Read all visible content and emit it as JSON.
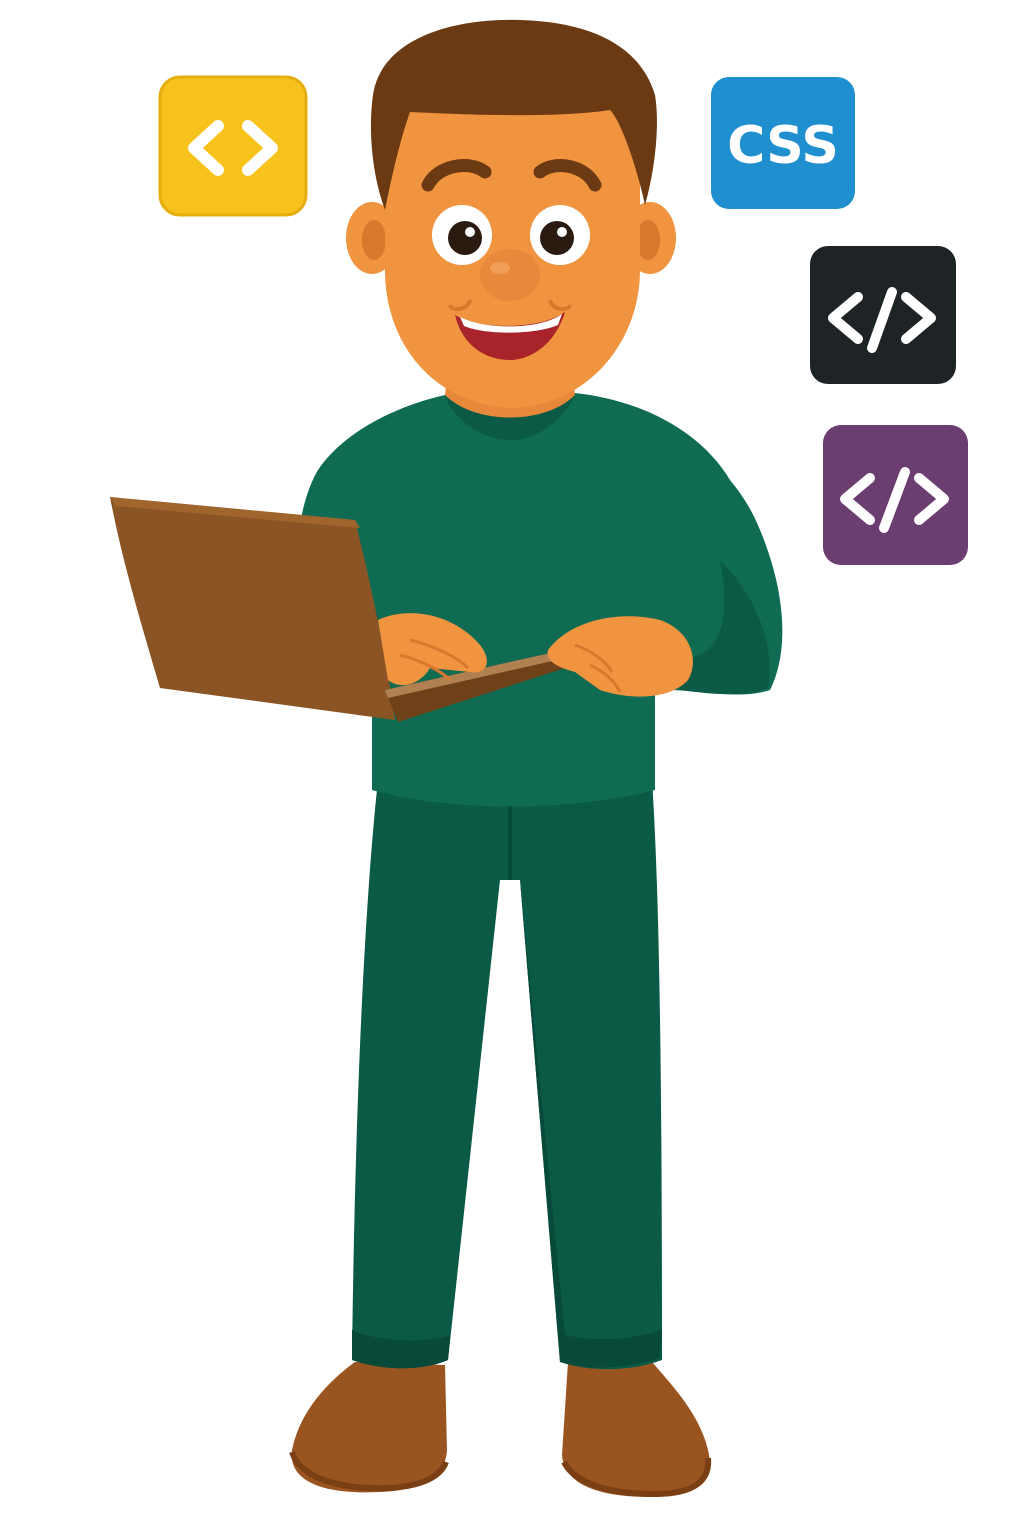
{
  "scene": {
    "subject": "developer-with-laptop",
    "colors": {
      "background": "#ffffff",
      "skin": "#f0943f",
      "skin_shadow": "#d9782c",
      "hair": "#6b3a12",
      "sweater": "#0f6b52",
      "sweater_shadow": "#0b5a45",
      "pants": "#0a5a45",
      "pants_shadow": "#084a39",
      "shoes": "#9a5420",
      "laptop": "#8a5424",
      "laptop_edge": "#6e4118",
      "mouth": "#a8232a"
    }
  },
  "tiles": [
    {
      "name": "html-tile",
      "icon": "angle-brackets-icon",
      "color": "#f7c21b",
      "label": ""
    },
    {
      "name": "css-tile",
      "icon": "css-text-icon",
      "color": "#1f8fcf",
      "label": "CSS"
    },
    {
      "name": "code-tile-dark",
      "icon": "code-slash-icon",
      "color": "#1e2426",
      "label": ""
    },
    {
      "name": "code-tile-purple",
      "icon": "code-slash-icon",
      "color": "#6b3d70",
      "label": ""
    }
  ]
}
